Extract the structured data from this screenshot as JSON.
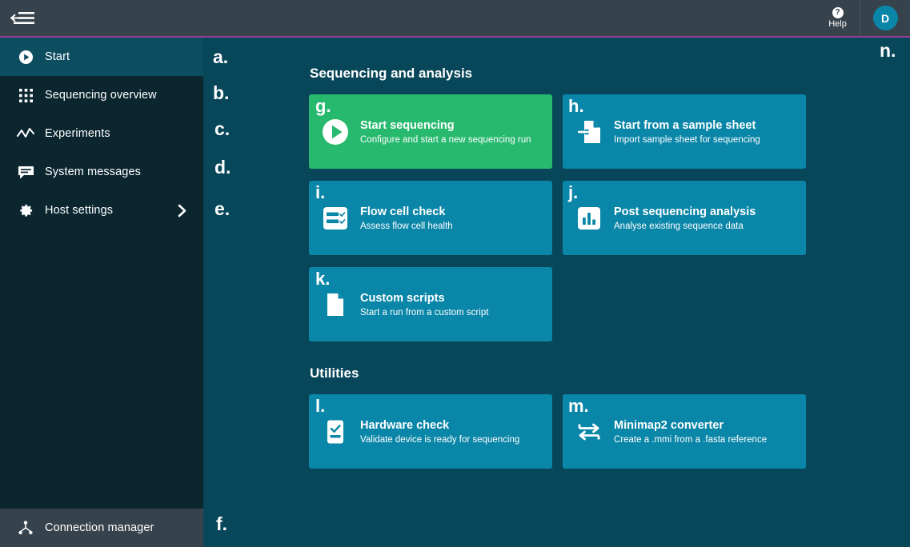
{
  "header": {
    "menu_icon": "back-menu-icon",
    "help_icon": "question-mark-icon",
    "help_label": "Help",
    "avatar_initial": "D"
  },
  "sidebar": {
    "items": [
      {
        "icon": "play-circle-icon",
        "label": "Start",
        "active": true
      },
      {
        "icon": "grid-dots-icon",
        "label": "Sequencing overview",
        "active": false
      },
      {
        "icon": "line-chart-icon",
        "label": "Experiments",
        "active": false
      },
      {
        "icon": "message-icon",
        "label": "System messages",
        "active": false
      },
      {
        "icon": "gear-icon",
        "label": "Host settings",
        "active": false,
        "chevron": "chevron-right-icon"
      }
    ],
    "bottom": {
      "icon": "connection-icon",
      "label": "Connection manager"
    }
  },
  "main": {
    "sections": [
      {
        "title": "Sequencing and analysis"
      },
      {
        "title": "Utilities"
      }
    ],
    "cards": [
      {
        "id": "start-sequencing",
        "letter": "g.",
        "icon": "play-circle-icon",
        "title": "Start sequencing",
        "subtitle": "Configure and start a new sequencing run",
        "color": "#27b96e"
      },
      {
        "id": "start-from-sample-sheet",
        "letter": "h.",
        "icon": "document-import-icon",
        "title": "Start from a sample sheet",
        "subtitle": "Import sample sheet for sequencing",
        "color": "#0a86a8"
      },
      {
        "id": "flow-cell-check",
        "letter": "i.",
        "icon": "checklist-icon",
        "title": "Flow cell check",
        "subtitle": "Assess flow cell health",
        "color": "#0a86a8"
      },
      {
        "id": "post-sequencing-analysis",
        "letter": "j.",
        "icon": "bar-chart-icon",
        "title": "Post sequencing analysis",
        "subtitle": "Analyse existing sequence data",
        "color": "#0a86a8"
      },
      {
        "id": "custom-scripts",
        "letter": "k.",
        "icon": "document-icon",
        "title": "Custom scripts",
        "subtitle": "Start a run from a custom script",
        "color": "#0a86a8"
      },
      {
        "id": "hardware-check",
        "letter": "l.",
        "icon": "device-check-icon",
        "title": "Hardware check",
        "subtitle": "Validate device is ready for sequencing",
        "color": "#0a86a8"
      },
      {
        "id": "minimap2-converter",
        "letter": "m.",
        "icon": "swap-arrows-icon",
        "title": "Minimap2 converter",
        "subtitle": "Create a .mmi from a .fasta reference",
        "color": "#0a86a8"
      }
    ]
  },
  "annotations": {
    "a": "a.",
    "b": "b.",
    "c": "c.",
    "d": "d.",
    "e": "e.",
    "f": "f.",
    "n": "n."
  },
  "colors": {
    "background": "#084659",
    "sidebar": "#0c2630",
    "sidebar_active": "#0d4d60",
    "header": "#37434c",
    "accent_line": "#9c3a94",
    "card_teal": "#0a86a8",
    "card_green": "#27b96e",
    "sidebar_bottom": "#37434c"
  }
}
